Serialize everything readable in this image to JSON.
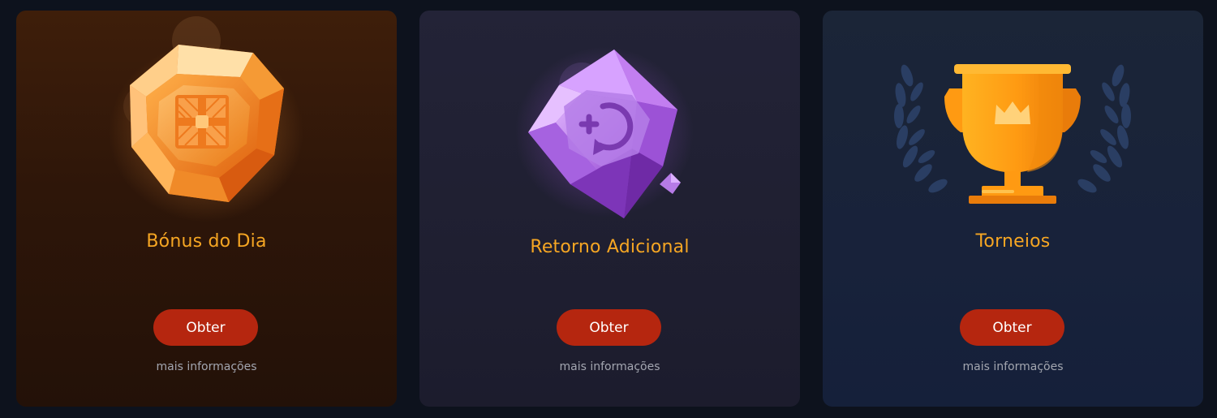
{
  "cards": [
    {
      "title": "Bónus do Dia",
      "button_label": "Obter",
      "link_text": "mais informações",
      "icon": "orange-gem-gift-icon",
      "accent": "#f6a623"
    },
    {
      "title": "Retorno Adicional",
      "button_label": "Obter",
      "link_text": "mais informações",
      "icon": "purple-crystal-cashback-icon",
      "accent": "#f6a623"
    },
    {
      "title": "Torneios",
      "button_label": "Obter",
      "link_text": "mais informações",
      "icon": "trophy-laurel-icon",
      "accent": "#f6a623"
    }
  ],
  "colors": {
    "button": "#b5260f",
    "title": "#f6a623",
    "link": "#a3a6b0",
    "background": "#0d121d"
  }
}
